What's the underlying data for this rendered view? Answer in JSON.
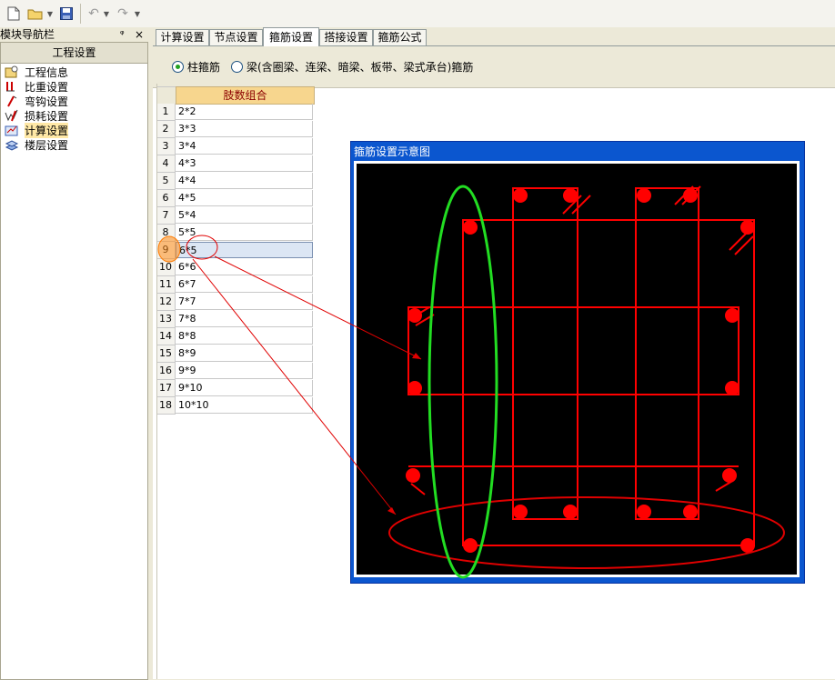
{
  "toolbar": {
    "buttons": [
      "new-file",
      "open-folder",
      "save",
      "undo",
      "redo"
    ]
  },
  "nav": {
    "title": "模块导航栏",
    "pin": "ᵠ",
    "close": "×",
    "header": "工程设置",
    "items": [
      {
        "label": "工程信息",
        "icon": "info-icon"
      },
      {
        "label": "比重设置",
        "icon": "weight-icon"
      },
      {
        "label": "弯钩设置",
        "icon": "hook-icon"
      },
      {
        "label": "损耗设置",
        "icon": "loss-icon"
      },
      {
        "label": "计算设置",
        "icon": "calc-icon"
      },
      {
        "label": "楼层设置",
        "icon": "floor-icon"
      }
    ]
  },
  "tabs": [
    "计算设置",
    "节点设置",
    "箍筋设置",
    "搭接设置",
    "箍筋公式"
  ],
  "options": {
    "radio1": "柱箍筋",
    "radio2": "梁(含圈梁、连梁、暗梁、板带、梁式承台)箍筋"
  },
  "grid": {
    "header": "肢数组合",
    "rows": [
      {
        "no": "1",
        "value": "2*2"
      },
      {
        "no": "2",
        "value": "3*3"
      },
      {
        "no": "3",
        "value": "3*4"
      },
      {
        "no": "4",
        "value": "4*3"
      },
      {
        "no": "5",
        "value": "4*4"
      },
      {
        "no": "6",
        "value": "4*5"
      },
      {
        "no": "7",
        "value": "5*4"
      },
      {
        "no": "8",
        "value": "5*5"
      },
      {
        "no": "9",
        "value": "6*5"
      },
      {
        "no": "10",
        "value": "6*6"
      },
      {
        "no": "11",
        "value": "6*7"
      },
      {
        "no": "12",
        "value": "7*7"
      },
      {
        "no": "13",
        "value": "7*8"
      },
      {
        "no": "14",
        "value": "8*8"
      },
      {
        "no": "15",
        "value": "8*9"
      },
      {
        "no": "16",
        "value": "9*9"
      },
      {
        "no": "17",
        "value": "9*10"
      },
      {
        "no": "18",
        "value": "10*10"
      }
    ]
  },
  "diagram": {
    "title": "箍筋设置示意图"
  },
  "colors": {
    "rebar": "#ff0000",
    "highlight_green": "#00dd00",
    "annotation_red": "#e00000"
  }
}
